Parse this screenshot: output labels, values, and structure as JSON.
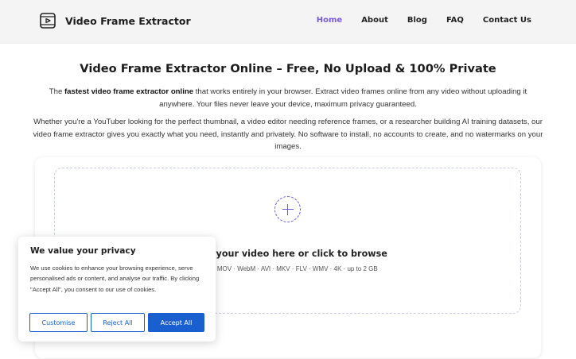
{
  "header": {
    "logo_text": "Video Frame Extractor",
    "logo_icon": "video-file-icon",
    "nav": [
      {
        "label": "Home",
        "active": true
      },
      {
        "label": "About",
        "active": false
      },
      {
        "label": "Blog",
        "active": false
      },
      {
        "label": "FAQ",
        "active": false
      },
      {
        "label": "Contact Us",
        "active": false
      }
    ]
  },
  "main": {
    "title": "Video Frame Extractor Online – Free, No Upload & 100% Private",
    "intro": {
      "prefix": "The ",
      "bold": "fastest video frame extractor online",
      "suffix": " that works entirely in your browser. Extract video frames online from any video without uploading it anywhere. Your files never leave your device, maximum privacy guaranteed."
    },
    "description": "Whether you're a YouTuber looking for the perfect thumbnail, a video editor needing reference frames, or a researcher building AI training datasets, our video frame extractor gives you exactly what you need, instantly and privately. No software to install, no accounts to create, and no watermarks on your images."
  },
  "dropzone": {
    "icon": "plus-circle-icon",
    "text": "Drop your video here or click to browse",
    "formats": "MP4 · MOV · WebM · AVI · MKV · FLV · WMV · 4K · up to 2 GB"
  },
  "cookie_banner": {
    "title": "We value your privacy",
    "text": "We use cookies to enhance your browsing experience, serve personalised ads or content, and analyse our traffic. By clicking \"Accept All\", you consent to our use of cookies.",
    "buttons": {
      "customise": "Customise",
      "reject": "Reject All",
      "accept": "Accept All"
    }
  },
  "colors": {
    "accent": "#7b5bd9",
    "primary_button": "#1a5fd0",
    "header_bg": "#f4f4f4"
  }
}
